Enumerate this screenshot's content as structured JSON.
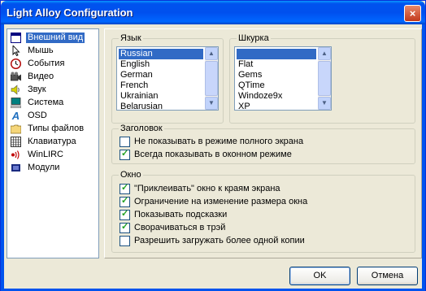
{
  "window": {
    "title": "Light Alloy Configuration",
    "close_label": "×"
  },
  "categories": [
    {
      "label": "Внешний вид",
      "icon": "window-icon",
      "selected": true
    },
    {
      "label": "Мышь",
      "icon": "mouse-cursor-icon"
    },
    {
      "label": "События",
      "icon": "clock-icon"
    },
    {
      "label": "Видео",
      "icon": "video-camera-icon"
    },
    {
      "label": "Звук",
      "icon": "speaker-icon"
    },
    {
      "label": "Система",
      "icon": "computer-icon"
    },
    {
      "label": "OSD",
      "icon": "osd-letter-icon"
    },
    {
      "label": "Типы файлов",
      "icon": "folder-icon"
    },
    {
      "label": "Клавиатура",
      "icon": "keyboard-icon"
    },
    {
      "label": "WinLIRC",
      "icon": "remote-signal-icon"
    },
    {
      "label": "Модули",
      "icon": "module-icon"
    }
  ],
  "language": {
    "legend": "Язык",
    "items": [
      "Russian",
      "English",
      "German",
      "French",
      "Ukrainian",
      "Belarusian"
    ],
    "selected_index": 0
  },
  "skin": {
    "legend": "Шкурка",
    "items": [
      "",
      "Flat",
      "Gems",
      "QTime",
      "Windoze9x",
      "XP"
    ],
    "selected_index": 0
  },
  "header_group": {
    "legend": "Заголовок",
    "options": [
      {
        "label": "Не показывать в режиме полного экрана",
        "checked": false
      },
      {
        "label": "Всегда показывать в оконном режиме",
        "checked": true
      }
    ]
  },
  "window_group": {
    "legend": "Окно",
    "options": [
      {
        "label": "\"Приклеивать\" окно к краям экрана",
        "checked": true
      },
      {
        "label": "Ограничение на изменение размера окна",
        "checked": true
      },
      {
        "label": "Показывать подсказки",
        "checked": true
      },
      {
        "label": "Сворачиваться в трэй",
        "checked": true
      },
      {
        "label": "Разрешить загружать более одной копии",
        "checked": false
      }
    ]
  },
  "buttons": {
    "ok": "OK",
    "cancel": "Отмена"
  },
  "check_mark": "✓",
  "scroll_up": "▲",
  "scroll_down": "▼"
}
